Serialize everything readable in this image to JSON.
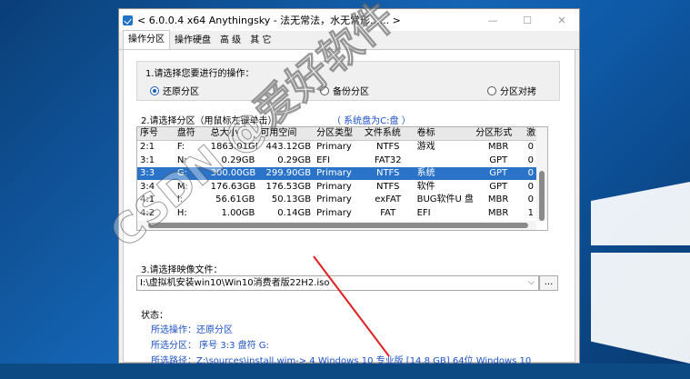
{
  "window": {
    "title": "< 6.0.0.4 x64 Anythingsky - 法无常法，水无常形...... >",
    "minimize": "—",
    "maximize": "☐",
    "close": "✕"
  },
  "tabs": [
    "操作分区",
    "操作硬盘",
    "高 级",
    "其 它"
  ],
  "step1": {
    "label": "1.请选择您要进行的操作：",
    "options": [
      "还原分区",
      "备份分区",
      "分区对拷"
    ],
    "selected": 0
  },
  "step2": {
    "label": "2.请选择分区（用鼠标左键单击）",
    "system_disk": "（ 系统盘为C:盘 ）",
    "columns": [
      "序号",
      "盘符",
      "总大小",
      "可用空间",
      "分区类型",
      "文件系统",
      "卷标",
      "分区形式",
      "激活"
    ],
    "rows": [
      [
        "2:1",
        "F:",
        "1863.01GB",
        "443.12GB",
        "Primary",
        "NTFS",
        "游戏",
        "MBR",
        "0"
      ],
      [
        "3:1",
        "N:",
        "0.29GB",
        "0.29GB",
        "EFI",
        "FAT32",
        "",
        "GPT",
        "0"
      ],
      [
        "3:3",
        "G:",
        "300.00GB",
        "299.90GB",
        "Primary",
        "NTFS",
        "系统",
        "GPT",
        "0"
      ],
      [
        "3:4",
        "M:",
        "176.63GB",
        "176.53GB",
        "Primary",
        "NTFS",
        "软件",
        "GPT",
        "0"
      ],
      [
        "4:1",
        "I:",
        "56.61GB",
        "50.13GB",
        "Primary",
        "exFAT",
        "BUG软件U 盘",
        "MBR",
        "0"
      ],
      [
        "4:2",
        "H:",
        "1.00GB",
        "0.14GB",
        "Primary",
        "FAT",
        "EFI",
        "MBR",
        "1"
      ]
    ],
    "selected_row": 2
  },
  "step3": {
    "label": "3.请选择映像文件：",
    "path": "I:\\虚拟机安装win10\\Win10消费者版22H2.iso",
    "browse": "..."
  },
  "status": {
    "label": "状态：",
    "lines": [
      "所选操作：还原分区",
      "所选分区：   序号 3:3          盘符 G:",
      "所选路径：Z:\\sources\\install.wim-> 4 Windows 10 专业版 [14.8 GB] 64位 Windows 10"
    ]
  },
  "watermark": "CSDN @爱好软件",
  "colors": {
    "accent": "#2a73c9",
    "status_text": "#1a4fc4",
    "desktop": "#0b4a83"
  }
}
